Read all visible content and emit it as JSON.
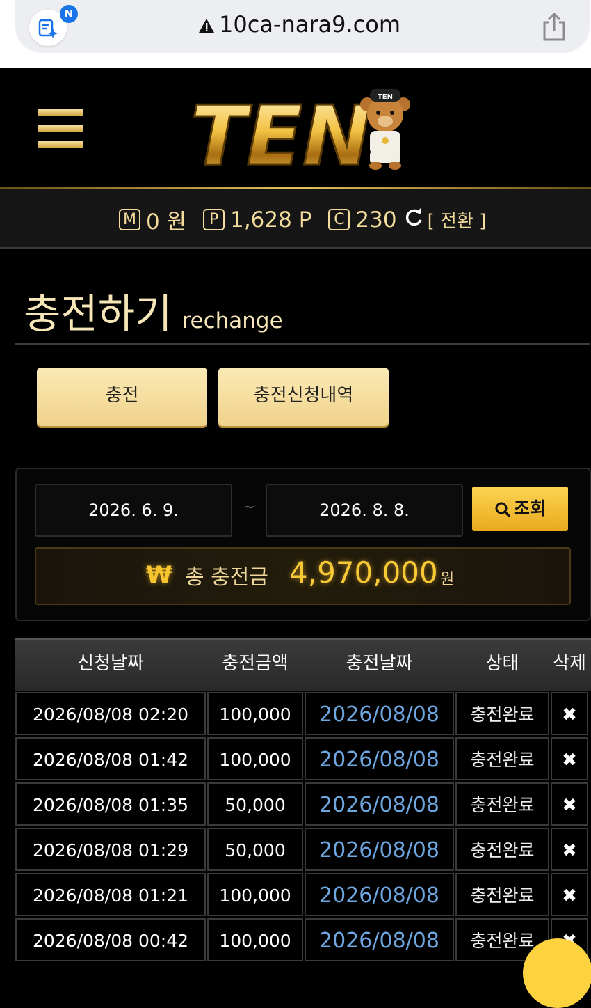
{
  "browser": {
    "url": "10ca-nara9.com",
    "ext_badge": "N"
  },
  "balance": {
    "m_icon": "M",
    "money": "0 원",
    "p_icon": "P",
    "points": "1,628 P",
    "c_icon": "C",
    "coins": "230",
    "convert": "[ 전환 ]"
  },
  "page": {
    "title": "충전하기",
    "subtitle": "rechange"
  },
  "tabs": [
    {
      "label": "충전"
    },
    {
      "label": "충전신청내역"
    }
  ],
  "search": {
    "start_date": "2026. 6. 9.",
    "separator": "~",
    "end_date": "2026. 8. 8.",
    "button": "조회"
  },
  "total": {
    "currency_symbol": "₩",
    "label": "총 충전금",
    "amount": "4,970,000",
    "unit": "원"
  },
  "table": {
    "headers": [
      "신청날짜",
      "충전금액",
      "충전날짜",
      "상태",
      "삭제"
    ],
    "rows": [
      {
        "requested": "2026/08/08 02:20",
        "amount": "100,000",
        "charged": "2026/08/08",
        "status": "충전완료",
        "delete": "✖"
      },
      {
        "requested": "2026/08/08 01:42",
        "amount": "100,000",
        "charged": "2026/08/08",
        "status": "충전완료",
        "delete": "✖"
      },
      {
        "requested": "2026/08/08 01:35",
        "amount": "50,000",
        "charged": "2026/08/08",
        "status": "충전완료",
        "delete": "✖"
      },
      {
        "requested": "2026/08/08 01:29",
        "amount": "50,000",
        "charged": "2026/08/08",
        "status": "충전완료",
        "delete": "✖"
      },
      {
        "requested": "2026/08/08 01:21",
        "amount": "100,000",
        "charged": "2026/08/08",
        "status": "충전완료",
        "delete": "✖"
      },
      {
        "requested": "2026/08/08 00:42",
        "amount": "100,000",
        "charged": "2026/08/08",
        "status": "충전완료",
        "delete": "✖"
      }
    ]
  },
  "logo": {
    "text": "TEN",
    "mascot_cap_text": "TEN"
  },
  "colors": {
    "gold": "#f3dc9c",
    "accent": "#f8c936",
    "link_blue": "#6ea6e0",
    "background": "#000000"
  }
}
